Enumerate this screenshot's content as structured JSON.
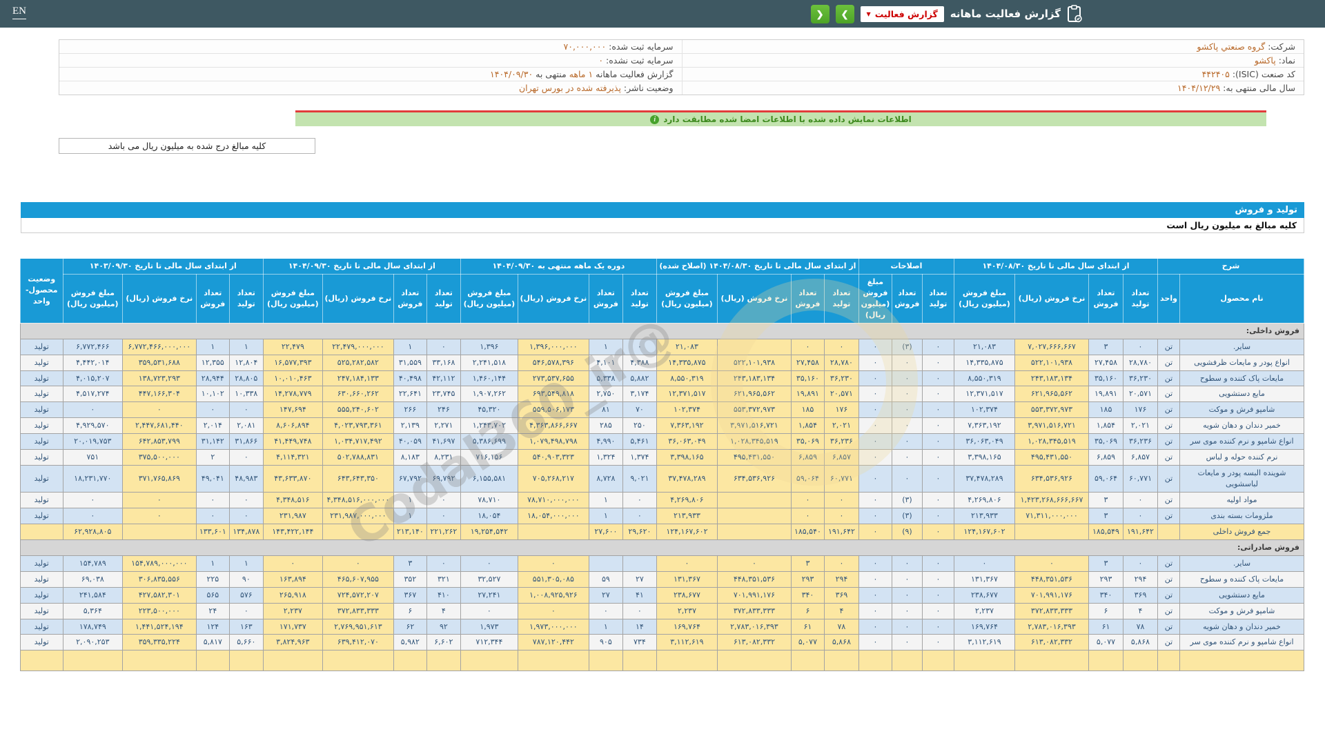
{
  "colors": {
    "appbar_bg": "#3e5862",
    "accent_blue": "#199ad6",
    "highlight_yellow": "#fce7a2",
    "row_blue": "#d3e3f3",
    "green_bar": "#c3e3af",
    "nav_green": "#52ae32",
    "red_line": "#e23b3b",
    "value_orange": "#b96a2b",
    "negative_red": "#dd0000"
  },
  "header": {
    "title": "گزارش فعالیت ماهانه",
    "dropdown_label": "گزارش فعالیت",
    "lang": "EN",
    "nav_back": "❮",
    "nav_forward": "❯"
  },
  "info": {
    "rows": [
      {
        "r": [
          [
            "lbl",
            "شرکت: "
          ],
          [
            "val",
            "گروه صنعتي پاکشو"
          ]
        ],
        "l": [
          [
            "lbl",
            "سرمایه ثبت شده: "
          ],
          [
            "val",
            "۷۰,۰۰۰,۰۰۰"
          ]
        ]
      },
      {
        "r": [
          [
            "lbl",
            "نماد: "
          ],
          [
            "val",
            "پاکشو"
          ]
        ],
        "l": [
          [
            "lbl",
            "سرمایه ثبت نشده: "
          ],
          [
            "val",
            "۰"
          ]
        ]
      },
      {
        "r": [
          [
            "lbl",
            "کد صنعت (ISIC): "
          ],
          [
            "val",
            "۴۴۲۴۰۵"
          ]
        ],
        "l": [
          [
            "lbl",
            "گزارش فعالیت ماهانه "
          ],
          [
            "val",
            "۱ ماهه"
          ],
          [
            "lbl",
            " منتهی به "
          ],
          [
            "val",
            "۱۴۰۴/۰۹/۳۰"
          ]
        ]
      },
      {
        "r": [
          [
            "lbl",
            "سال مالی منتهی به: "
          ],
          [
            "val",
            "۱۴۰۴/۱۲/۲۹"
          ]
        ],
        "l": [
          [
            "lbl",
            "وضعیت ناشر: "
          ],
          [
            "val",
            "پذیرفته شده در بورس تهران"
          ]
        ]
      }
    ]
  },
  "notices": {
    "signed_match": "اطلاعات نمایش داده شده با اطلاعات امضا شده مطابقت دارد",
    "amounts_note": "کلیه مبالغ درج شده به میلیون ریال می باشد"
  },
  "section": {
    "title": "تولید و فروش",
    "subtitle": "کلیه مبالغ به میلیون ریال است"
  },
  "watermark": "@Codal360_ir",
  "table": {
    "groups": [
      {
        "label": "شرح",
        "sub": [
          "نام محصول",
          "واحد"
        ]
      },
      {
        "label": "از ابتدای سال مالی تا تاریخ ۱۴۰۴/۰۸/۳۰",
        "sub": [
          "تعداد تولید",
          "تعداد فروش",
          "نرخ فروش (ریال)",
          "مبلغ فروش (میلیون ریال)"
        ]
      },
      {
        "label": "اصلاحات",
        "sub": [
          "تعداد تولید",
          "تعداد فروش",
          "مبلغ فروش (میلیون ریال)"
        ]
      },
      {
        "label": "از ابتدای سال مالی تا تاریخ ۱۴۰۴/۰۸/۳۰ (اصلاح شده)",
        "sub": [
          "تعداد تولید",
          "تعداد فروش",
          "نرخ فروش (ریال)",
          "مبلغ فروش (میلیون ریال)"
        ]
      },
      {
        "label": "دوره یک ماهه منتهی به ۱۴۰۴/۰۹/۳۰",
        "sub": [
          "تعداد تولید",
          "تعداد فروش",
          "نرخ فروش (ریال)",
          "مبلغ فروش (میلیون ریال)"
        ]
      },
      {
        "label": "از ابتدای سال مالی تا تاریخ ۱۴۰۴/۰۹/۳۰",
        "sub": [
          "تعداد تولید",
          "تعداد فروش",
          "نرخ فروش (ریال)",
          "مبلغ فروش (میلیون ریال)"
        ]
      },
      {
        "label": "از ابتدای سال مالی تا تاریخ ۱۴۰۳/۰۹/۳۰",
        "sub": [
          "تعداد تولید",
          "تعداد فروش",
          "نرخ فروش (ریال)",
          "مبلغ فروش (میلیون ریال)"
        ]
      },
      {
        "label": "وضعیت محصول-واحد",
        "sub": []
      }
    ],
    "rows": [
      {
        "t": "sec",
        "label": "فروش داخلی:"
      },
      {
        "t": "row",
        "cells": [
          "سایر.",
          "تن",
          "۰",
          "۳",
          "۷,۰۲۷,۶۶۶,۶۶۷",
          "۲۱,۰۸۳",
          "۰",
          "(۳)",
          "۰",
          "۰",
          "۰",
          "",
          "۲۱,۰۸۳",
          "۰",
          "۱",
          "۱,۳۹۶,۰۰۰,۰۰۰",
          "۱,۳۹۶",
          "۰",
          "۱",
          "۲۲,۴۷۹,۰۰۰,۰۰۰",
          "۲۲,۴۷۹",
          "۱",
          "۱",
          "۶,۷۷۲,۴۶۶,۰۰۰,۰۰۰",
          "۶,۷۷۲,۴۶۶",
          "تولید"
        ]
      },
      {
        "t": "row",
        "cells": [
          "انواع پودر و مایعات ظرفشویی",
          "تن",
          "۲۸,۷۸۰",
          "۲۷,۴۵۸",
          "۵۲۲,۱۰۱,۹۳۸",
          "۱۴,۳۳۵,۸۷۵",
          "۰",
          "۰",
          "۰",
          "۲۸,۷۸۰",
          "۲۷,۴۵۸",
          "۵۲۲,۱۰۱,۹۳۸",
          "۱۴,۳۳۵,۸۷۵",
          "۴,۳۸۸",
          "۴,۱۰۱",
          "۵۴۶,۵۷۸,۳۹۶",
          "۲,۲۴۱,۵۱۸",
          "۳۳,۱۶۸",
          "۳۱,۵۵۹",
          "۵۲۵,۲۸۲,۵۸۲",
          "۱۶,۵۷۷,۳۹۳",
          "۱۲,۸۰۴",
          "۱۲,۳۵۵",
          "۳۵۹,۵۳۱,۶۸۸",
          "۴,۴۴۲,۰۱۴",
          "تولید"
        ]
      },
      {
        "t": "row",
        "cells": [
          "مایعات پاک کننده و سطوح",
          "تن",
          "۳۶,۲۳۰",
          "۳۵,۱۶۰",
          "۲۴۳,۱۸۳,۱۳۴",
          "۸,۵۵۰,۳۱۹",
          "۰",
          "۰",
          "۰",
          "۳۶,۲۳۰",
          "۳۵,۱۶۰",
          "۲۴۳,۱۸۳,۱۳۴",
          "۸,۵۵۰,۳۱۹",
          "۵,۸۸۲",
          "۵,۳۳۸",
          "۲۷۳,۵۳۷,۶۵۵",
          "۱,۴۶۰,۱۴۴",
          "۴۲,۱۱۲",
          "۴۰,۴۹۸",
          "۲۴۷,۱۸۴,۱۳۳",
          "۱۰,۰۱۰,۴۶۳",
          "۲۸,۸۰۵",
          "۲۸,۹۴۴",
          "۱۳۸,۷۲۳,۲۹۳",
          "۴,۰۱۵,۲۰۷",
          "تولید"
        ]
      },
      {
        "t": "row",
        "cells": [
          "مایع دستشویی",
          "تن",
          "۲۰,۵۷۱",
          "۱۹,۸۹۱",
          "۶۲۱,۹۶۵,۵۶۲",
          "۱۲,۳۷۱,۵۱۷",
          "۰",
          "۰",
          "۰",
          "۲۰,۵۷۱",
          "۱۹,۸۹۱",
          "۶۲۱,۹۶۵,۵۶۲",
          "۱۲,۳۷۱,۵۱۷",
          "۳,۱۷۴",
          "۲,۷۵۰",
          "۶۹۳,۵۴۹,۸۱۸",
          "۱,۹۰۷,۲۶۲",
          "۲۳,۷۴۵",
          "۲۲,۶۴۱",
          "۶۳۰,۶۶۰,۲۶۲",
          "۱۴,۲۷۸,۷۷۹",
          "۱۰,۳۳۸",
          "۱۰,۱۰۲",
          "۴۴۷,۱۶۶,۳۰۴",
          "۴,۵۱۷,۲۷۴",
          "تولید"
        ]
      },
      {
        "t": "row",
        "cells": [
          "شامپو فرش و موکت",
          "تن",
          "۱۷۶",
          "۱۸۵",
          "۵۵۳,۳۷۲,۹۷۳",
          "۱۰۲,۳۷۴",
          "۰",
          "۰",
          "۰",
          "۱۷۶",
          "۱۸۵",
          "۵۵۳,۳۷۲,۹۷۳",
          "۱۰۲,۳۷۴",
          "۷۰",
          "۸۱",
          "۵۵۹,۵۰۶,۱۷۳",
          "۴۵,۳۲۰",
          "۲۴۶",
          "۲۶۶",
          "۵۵۵,۲۴۰,۶۰۲",
          "۱۴۷,۶۹۴",
          "۰",
          "۰",
          "۰",
          "۰",
          "تولید"
        ]
      },
      {
        "t": "row",
        "cells": [
          "خمیر دندان و دهان شویه",
          "تن",
          "۲,۰۲۱",
          "۱,۸۵۴",
          "۳,۹۷۱,۵۱۶,۷۲۱",
          "۷,۳۶۳,۱۹۲",
          "۰",
          "۰",
          "۰",
          "۲,۰۲۱",
          "۱,۸۵۴",
          "۳,۹۷۱,۵۱۶,۷۲۱",
          "۷,۳۶۳,۱۹۲",
          "۲۵۰",
          "۲۸۵",
          "۴,۳۶۳,۸۶۶,۶۶۷",
          "۱,۲۴۳,۷۰۲",
          "۲,۲۷۱",
          "۲,۱۳۹",
          "۴,۰۲۳,۷۹۳,۳۶۱",
          "۸,۶۰۶,۸۹۴",
          "۲,۰۸۱",
          "۲,۰۱۴",
          "۲,۴۴۷,۶۸۱,۴۴۰",
          "۴,۹۲۹,۵۷۰",
          "تولید"
        ]
      },
      {
        "t": "row",
        "cells": [
          "انواع شامپو و نرم کننده موی سر",
          "تن",
          "۳۶,۲۳۶",
          "۳۵,۰۶۹",
          "۱,۰۲۸,۳۴۵,۵۱۹",
          "۳۶,۰۶۳,۰۴۹",
          "۰",
          "۰",
          "۰",
          "۳۶,۲۳۶",
          "۳۵,۰۶۹",
          "۱,۰۲۸,۳۴۵,۵۱۹",
          "۳۶,۰۶۳,۰۴۹",
          "۵,۴۶۱",
          "۴,۹۹۰",
          "۱,۰۷۹,۴۹۸,۷۹۸",
          "۵,۳۸۶,۶۹۹",
          "۴۱,۶۹۷",
          "۴۰,۰۵۹",
          "۱,۰۳۴,۷۱۷,۴۹۲",
          "۴۱,۴۴۹,۷۴۸",
          "۳۱,۸۶۶",
          "۳۱,۱۴۲",
          "۶۴۲,۸۵۳,۷۹۹",
          "۲۰,۰۱۹,۷۵۳",
          "تولید"
        ]
      },
      {
        "t": "row",
        "cells": [
          "نرم کننده حوله و لباس",
          "تن",
          "۶,۸۵۷",
          "۶,۸۵۹",
          "۴۹۵,۴۳۱,۵۵۰",
          "۳,۳۹۸,۱۶۵",
          "۰",
          "۰",
          "۰",
          "۶,۸۵۷",
          "۶,۸۵۹",
          "۴۹۵,۴۳۱,۵۵۰",
          "۳,۳۹۸,۱۶۵",
          "۱,۳۷۴",
          "۱,۳۲۴",
          "۵۴۰,۹۰۳,۳۲۳",
          "۷۱۶,۱۵۶",
          "۸,۲۳۱",
          "۸,۱۸۳",
          "۵۰۲,۷۸۸,۸۳۱",
          "۴,۱۱۴,۳۲۱",
          "۰",
          "۲",
          "۳۷۵,۵۰۰,۰۰۰",
          "۷۵۱",
          "تولید"
        ]
      },
      {
        "t": "row",
        "cells": [
          "شوینده البسه پودر و مایعات لباسشویی",
          "تن",
          "۶۰,۷۷۱",
          "۵۹,۰۶۴",
          "۶۳۴,۵۳۶,۹۲۶",
          "۳۷,۴۷۸,۲۸۹",
          "۰",
          "۰",
          "۰",
          "۶۰,۷۷۱",
          "۵۹,۰۶۴",
          "۶۳۴,۵۳۶,۹۲۶",
          "۳۷,۴۷۸,۲۸۹",
          "۹,۰۲۱",
          "۸,۷۲۸",
          "۷۰۵,۲۶۸,۲۱۷",
          "۶,۱۵۵,۵۸۱",
          "۶۹,۷۹۲",
          "۶۷,۷۹۲",
          "۶۴۳,۶۴۳,۳۵۰",
          "۴۳,۶۳۳,۸۷۰",
          "۴۸,۹۸۳",
          "۴۹,۰۴۱",
          "۳۷۱,۷۶۵,۸۶۹",
          "۱۸,۲۳۱,۷۷۰",
          "تولید"
        ]
      },
      {
        "t": "row",
        "cells": [
          "مواد اولیه",
          "تن",
          "۰",
          "۳",
          "۱,۴۲۳,۲۶۸,۶۶۶,۶۶۷",
          "۴,۲۶۹,۸۰۶",
          "۰",
          "(۳)",
          "۰",
          "۰",
          "۰",
          "",
          "۴,۲۶۹,۸۰۶",
          "۰",
          "۱",
          "۷۸,۷۱۰,۰۰۰,۰۰۰",
          "۷۸,۷۱۰",
          "۰",
          "۱",
          "۴,۳۴۸,۵۱۶,۰۰۰,۰۰۰",
          "۴,۳۴۸,۵۱۶",
          "۰",
          "۰",
          "۰",
          "۰",
          "تولید"
        ]
      },
      {
        "t": "row",
        "cells": [
          "ملزومات بسته بندی",
          "تن",
          "۰",
          "۳",
          "۷۱,۳۱۱,۰۰۰,۰۰۰",
          "۲۱۳,۹۳۳",
          "۰",
          "(۳)",
          "۰",
          "۰",
          "۰",
          "",
          "۲۱۳,۹۳۳",
          "۰",
          "۱",
          "۱۸,۰۵۴,۰۰۰,۰۰۰",
          "۱۸,۰۵۴",
          "۰",
          "۱",
          "۲۳۱,۹۸۷,۰۰۰,۰۰۰",
          "۲۳۱,۹۸۷",
          "۰",
          "۰",
          "۰",
          "۰",
          "تولید"
        ]
      },
      {
        "t": "total",
        "cells": [
          "جمع فروش داخلی",
          "",
          "۱۹۱,۶۴۲",
          "۱۸۵,۵۴۹",
          "",
          "۱۲۴,۱۶۷,۶۰۲",
          "۰",
          "(۹)",
          "۰",
          "۱۹۱,۶۴۲",
          "۱۸۵,۵۴۰",
          "",
          "۱۲۴,۱۶۷,۶۰۲",
          "۲۹,۶۲۰",
          "۲۷,۶۰۰",
          "",
          "۱۹,۲۵۴,۵۴۲",
          "۲۲۱,۲۶۲",
          "۲۱۳,۱۴۰",
          "",
          "۱۴۳,۴۲۲,۱۴۴",
          "۱۳۴,۸۷۸",
          "۱۳۳,۶۰۱",
          "",
          "۶۲,۹۲۸,۸۰۵",
          ""
        ]
      },
      {
        "t": "sec",
        "label": "فروش صادراتی:"
      },
      {
        "t": "row",
        "cells": [
          "سایر.",
          "تن",
          "۰",
          "۳",
          "۰",
          "۰",
          "۰",
          "۰",
          "۰",
          "۰",
          "۳",
          "۰",
          "۰",
          "",
          "",
          "۰",
          "۰",
          "۰",
          "۳",
          "۰",
          "۰",
          "۱",
          "۱",
          "۱۵۴,۷۸۹,۰۰۰,۰۰۰",
          "۱۵۴,۷۸۹",
          "تولید"
        ]
      },
      {
        "t": "row",
        "cells": [
          "مایعات پاک کننده و سطوح",
          "تن",
          "۲۹۴",
          "۲۹۳",
          "۴۴۸,۳۵۱,۵۳۶",
          "۱۳۱,۳۶۷",
          "۰",
          "۰",
          "۰",
          "۲۹۴",
          "۲۹۳",
          "۴۴۸,۳۵۱,۵۳۶",
          "۱۳۱,۳۶۷",
          "۲۷",
          "۵۹",
          "۵۵۱,۳۰۵,۰۸۵",
          "۳۲,۵۲۷",
          "۳۲۱",
          "۳۵۲",
          "۴۶۵,۶۰۷,۹۵۵",
          "۱۶۳,۸۹۴",
          "۹۰",
          "۲۲۵",
          "۳۰۶,۸۳۵,۵۵۶",
          "۶۹,۰۳۸",
          "تولید"
        ]
      },
      {
        "t": "row",
        "cells": [
          "مایع دستشویی",
          "تن",
          "۳۶۹",
          "۳۴۰",
          "۷۰۱,۹۹۱,۱۷۶",
          "۲۳۸,۶۷۷",
          "۰",
          "۰",
          "۰",
          "۳۶۹",
          "۳۴۰",
          "۷۰۱,۹۹۱,۱۷۶",
          "۲۳۸,۶۷۷",
          "۴۱",
          "۲۷",
          "۱,۰۰۸,۹۲۵,۹۲۶",
          "۲۷,۲۴۱",
          "۴۱۰",
          "۳۶۷",
          "۷۲۴,۵۷۲,۲۰۷",
          "۲۶۵,۹۱۸",
          "۵۷۶",
          "۵۶۵",
          "۴۲۷,۵۸۲,۳۰۱",
          "۲۴۱,۵۸۴",
          "تولید"
        ]
      },
      {
        "t": "row",
        "cells": [
          "شامپو فرش و موکت",
          "تن",
          "۴",
          "۶",
          "۳۷۲,۸۳۳,۳۳۳",
          "۲,۲۳۷",
          "۰",
          "۰",
          "۰",
          "۴",
          "۶",
          "۳۷۲,۸۳۳,۳۳۳",
          "۲,۲۳۷",
          "۰",
          "۰",
          "۰",
          "۰",
          "۴",
          "۶",
          "۳۷۲,۸۳۳,۳۳۳",
          "۲,۲۳۷",
          "۰",
          "۲۴",
          "۲۲۳,۵۰۰,۰۰۰",
          "۵,۳۶۴",
          "تولید"
        ]
      },
      {
        "t": "row",
        "cells": [
          "خمیر دندان و دهان شویه",
          "تن",
          "۷۸",
          "۶۱",
          "۲,۷۸۳,۰۱۶,۳۹۳",
          "۱۶۹,۷۶۴",
          "۰",
          "۰",
          "۰",
          "۷۸",
          "۶۱",
          "۲,۷۸۳,۰۱۶,۳۹۳",
          "۱۶۹,۷۶۴",
          "۱۴",
          "۱",
          "۱,۹۷۳,۰۰۰,۰۰۰",
          "۱,۹۷۳",
          "۹۲",
          "۶۲",
          "۲,۷۶۹,۹۵۱,۶۱۳",
          "۱۷۱,۷۳۷",
          "۱۶۳",
          "۱۲۴",
          "۱,۴۴۱,۵۲۴,۱۹۴",
          "۱۷۸,۷۴۹",
          "تولید"
        ]
      },
      {
        "t": "row",
        "cells": [
          "انواع شامپو و نرم کننده موی سر",
          "تن",
          "۵,۸۶۸",
          "۵,۰۷۷",
          "۶۱۳,۰۸۲,۳۳۲",
          "۳,۱۱۲,۶۱۹",
          "۰",
          "۰",
          "۰",
          "۵,۸۶۸",
          "۵,۰۷۷",
          "۶۱۳,۰۸۲,۳۳۲",
          "۳,۱۱۲,۶۱۹",
          "۷۳۴",
          "۹۰۵",
          "۷۸۷,۱۲۰,۴۴۲",
          "۷۱۲,۳۴۴",
          "۶,۶۰۲",
          "۵,۹۸۲",
          "۶۳۹,۴۱۲,۰۷۰",
          "۳,۸۲۴,۹۶۳",
          "۵,۶۶۰",
          "۵,۸۱۷",
          "۳۵۹,۳۳۵,۲۲۴",
          "۲,۰۹۰,۲۵۳",
          "تولید"
        ]
      },
      {
        "t": "cut"
      }
    ]
  }
}
